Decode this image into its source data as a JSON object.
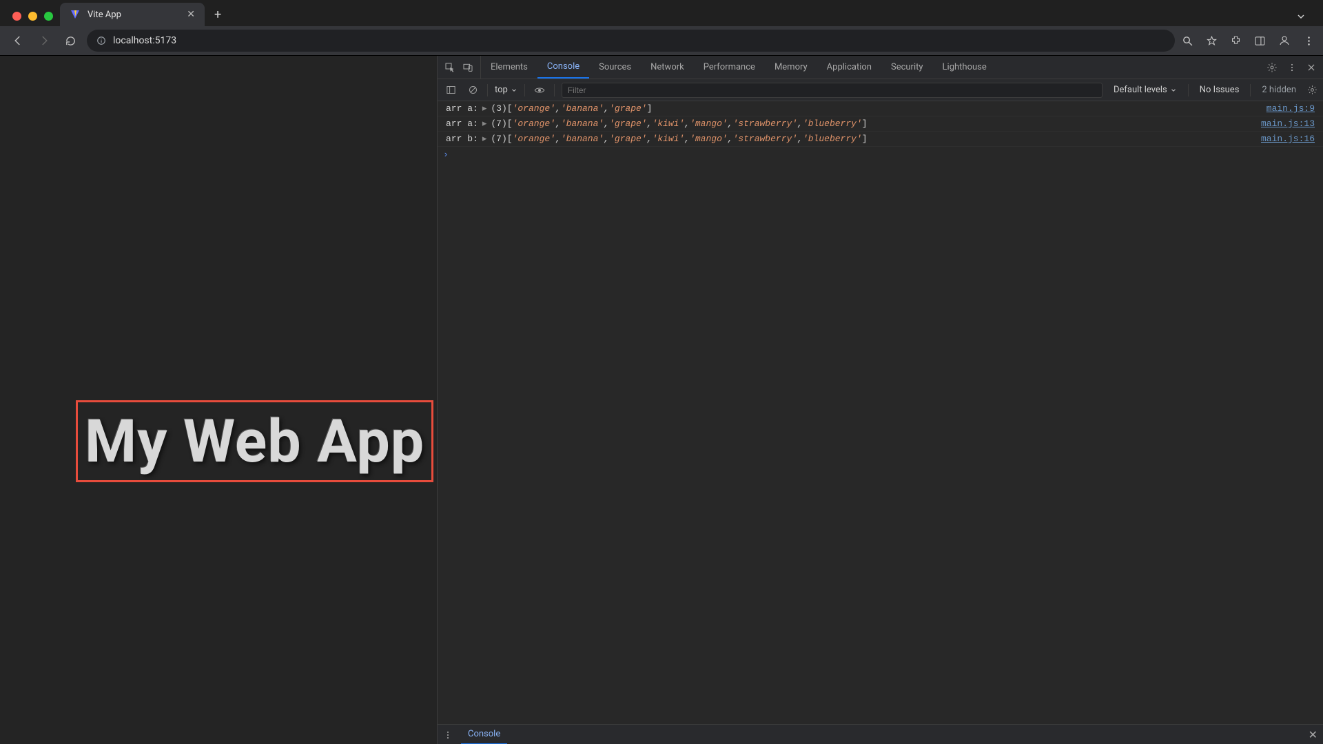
{
  "browser": {
    "tab_title": "Vite App",
    "address": "localhost:5173"
  },
  "page": {
    "heading": "My Web App"
  },
  "devtools": {
    "tabs": [
      "Elements",
      "Console",
      "Sources",
      "Network",
      "Performance",
      "Memory",
      "Application",
      "Security",
      "Lighthouse"
    ],
    "active_tab": "Console",
    "console_toolbar": {
      "context": "top",
      "filter_placeholder": "Filter",
      "levels_label": "Default levels",
      "issues_label": "No Issues",
      "hidden_label": "2 hidden"
    },
    "logs": [
      {
        "label": "arr a:",
        "count": 3,
        "items": [
          "orange",
          "banana",
          "grape"
        ],
        "source": "main.js:9"
      },
      {
        "label": "arr a:",
        "count": 7,
        "items": [
          "orange",
          "banana",
          "grape",
          "kiwi",
          "mango",
          "strawberry",
          "blueberry"
        ],
        "source": "main.js:13"
      },
      {
        "label": "arr b:",
        "count": 7,
        "items": [
          "orange",
          "banana",
          "grape",
          "kiwi",
          "mango",
          "strawberry",
          "blueberry"
        ],
        "source": "main.js:16"
      }
    ],
    "drawer_tab": "Console"
  }
}
